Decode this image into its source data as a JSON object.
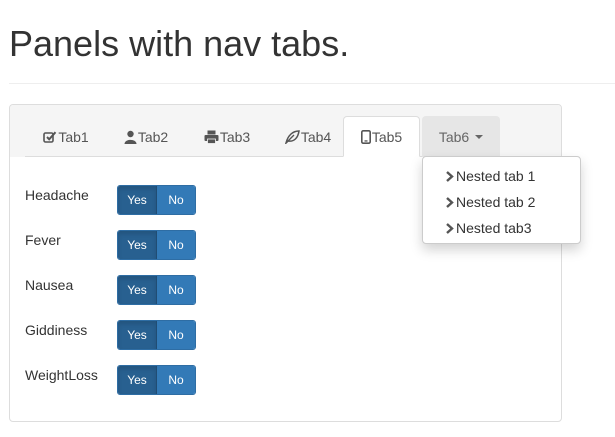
{
  "page": {
    "title": "Panels with nav tabs."
  },
  "tabs": [
    {
      "label": "Tab1",
      "icon": "check-square-icon"
    },
    {
      "label": "Tab2",
      "icon": "user-icon"
    },
    {
      "label": "Tab3",
      "icon": "print-icon"
    },
    {
      "label": "Tab4",
      "icon": "leaf-icon"
    },
    {
      "label": "Tab5",
      "icon": "mobile-icon",
      "active": true
    },
    {
      "label": "Tab6",
      "icon": "caret-down-icon",
      "dropdown_open": true
    }
  ],
  "dropdown": {
    "items": [
      {
        "label": "Nested tab 1",
        "icon": "chevron-right-icon"
      },
      {
        "label": "Nested tab 2",
        "icon": "chevron-right-icon"
      },
      {
        "label": "Nested tab3",
        "icon": "chevron-right-icon"
      }
    ]
  },
  "rows": [
    {
      "label": "Headache",
      "yes": "Yes",
      "no": "No",
      "selected": "Yes"
    },
    {
      "label": "Fever",
      "yes": "Yes",
      "no": "No",
      "selected": "Yes"
    },
    {
      "label": "Nausea",
      "yes": "Yes",
      "no": "No",
      "selected": "Yes"
    },
    {
      "label": "Giddiness",
      "yes": "Yes",
      "no": "No",
      "selected": "Yes"
    },
    {
      "label": "WeightLoss",
      "yes": "Yes",
      "no": "No",
      "selected": "Yes"
    }
  ],
  "colors": {
    "primary": "#337ab7",
    "primary_active": "#286090",
    "panel_heading": "#f5f5f5",
    "border": "#dddddd"
  }
}
